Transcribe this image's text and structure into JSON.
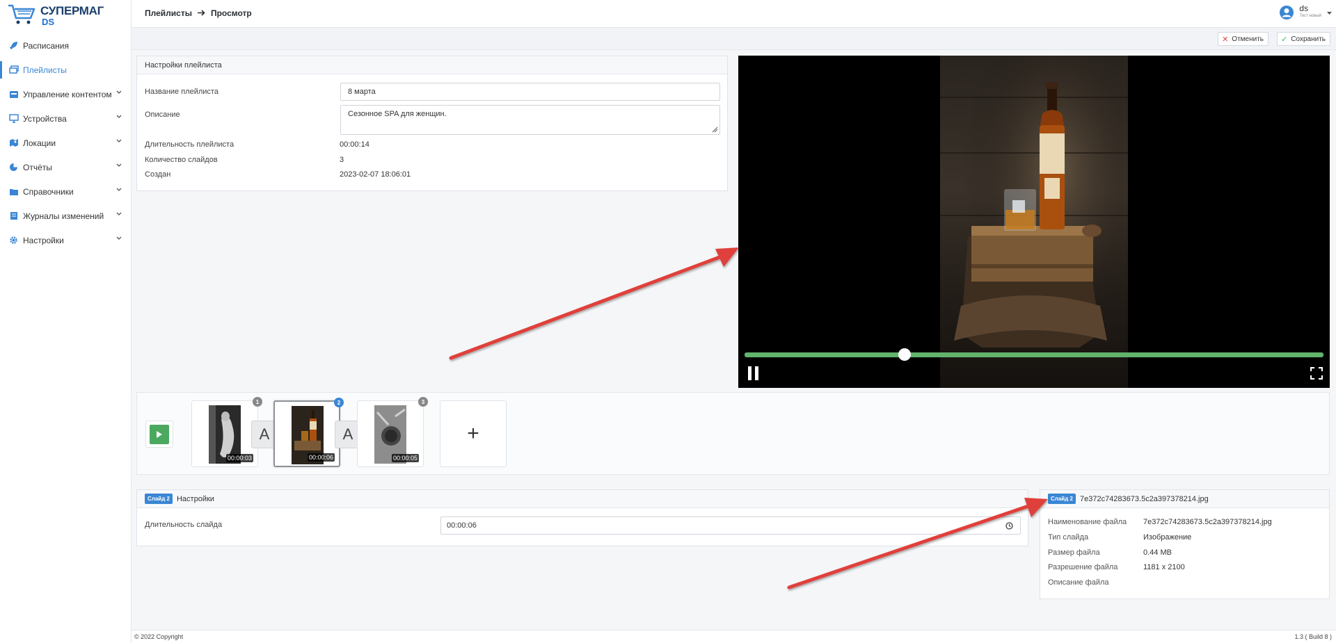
{
  "app": {
    "logo_line1": "СУПЕРМАГ",
    "logo_line2": "DS"
  },
  "sidebar": {
    "items": [
      {
        "label": "Расписания",
        "icon": "rocket-icon",
        "active": false,
        "expandable": false
      },
      {
        "label": "Плейлисты",
        "icon": "playlists-icon",
        "active": true,
        "expandable": false
      },
      {
        "label": "Управление контентом",
        "icon": "content-icon",
        "active": false,
        "expandable": true
      },
      {
        "label": "Устройства",
        "icon": "monitor-icon",
        "active": false,
        "expandable": true
      },
      {
        "label": "Локации",
        "icon": "map-icon",
        "active": false,
        "expandable": true
      },
      {
        "label": "Отчёты",
        "icon": "pie-chart-icon",
        "active": false,
        "expandable": true
      },
      {
        "label": "Справочники",
        "icon": "folder-icon",
        "active": false,
        "expandable": true
      },
      {
        "label": "Журналы изменений",
        "icon": "book-icon",
        "active": false,
        "expandable": true
      },
      {
        "label": "Настройки",
        "icon": "gear-icon",
        "active": false,
        "expandable": true
      }
    ]
  },
  "header": {
    "crumb1": "Плейлисты",
    "crumb2": "Просмотр",
    "user_name": "ds",
    "user_role": "Тест новый"
  },
  "toolbar": {
    "cancel_label": "Отменить",
    "save_label": "Сохранить"
  },
  "settings": {
    "title": "Настройки плейлиста",
    "name_label": "Название плейлиста",
    "name_value": "8 марта",
    "desc_label": "Описание",
    "desc_value": "Сезонное SPA для женщин.",
    "duration_label": "Длительность плейлиста",
    "duration_value": "00:00:14",
    "count_label": "Количество слайдов",
    "count_value": "3",
    "created_label": "Создан",
    "created_value": "2023-02-07 18:06:01"
  },
  "player": {
    "progress": 0.276
  },
  "slides": [
    {
      "num": "1",
      "duration": "00:00:03",
      "selected": false
    },
    {
      "num": "2",
      "duration": "00:00:06",
      "selected": true
    },
    {
      "num": "3",
      "duration": "00:00:05",
      "selected": false
    }
  ],
  "transition_label": "A",
  "add_label": "+",
  "slide_settings": {
    "badge": "Слайд 2",
    "title": "Настройки",
    "duration_label": "Длительность слайда",
    "duration_value": "00:00:06"
  },
  "file_info": {
    "badge": "Слайд 2",
    "title": "7e372c74283673.5c2a397378214.jpg",
    "filename_label": "Наименование файла",
    "filename_value": "7e372c74283673.5c2a397378214.jpg",
    "type_label": "Тип слайда",
    "type_value": "Изображение",
    "size_label": "Размер файла",
    "size_value": "0.44 MB",
    "resolution_label": "Разрешение файла",
    "resolution_value": "1181 x 2100",
    "desc_label": "Описание файла"
  },
  "footer": {
    "copyright": "© 2022 Copyright",
    "build": "1.3 ( Build 8 )"
  },
  "colors": {
    "accent": "#3a86d4",
    "progress": "#62b36c",
    "annotation_arrow": "#e0413a"
  }
}
